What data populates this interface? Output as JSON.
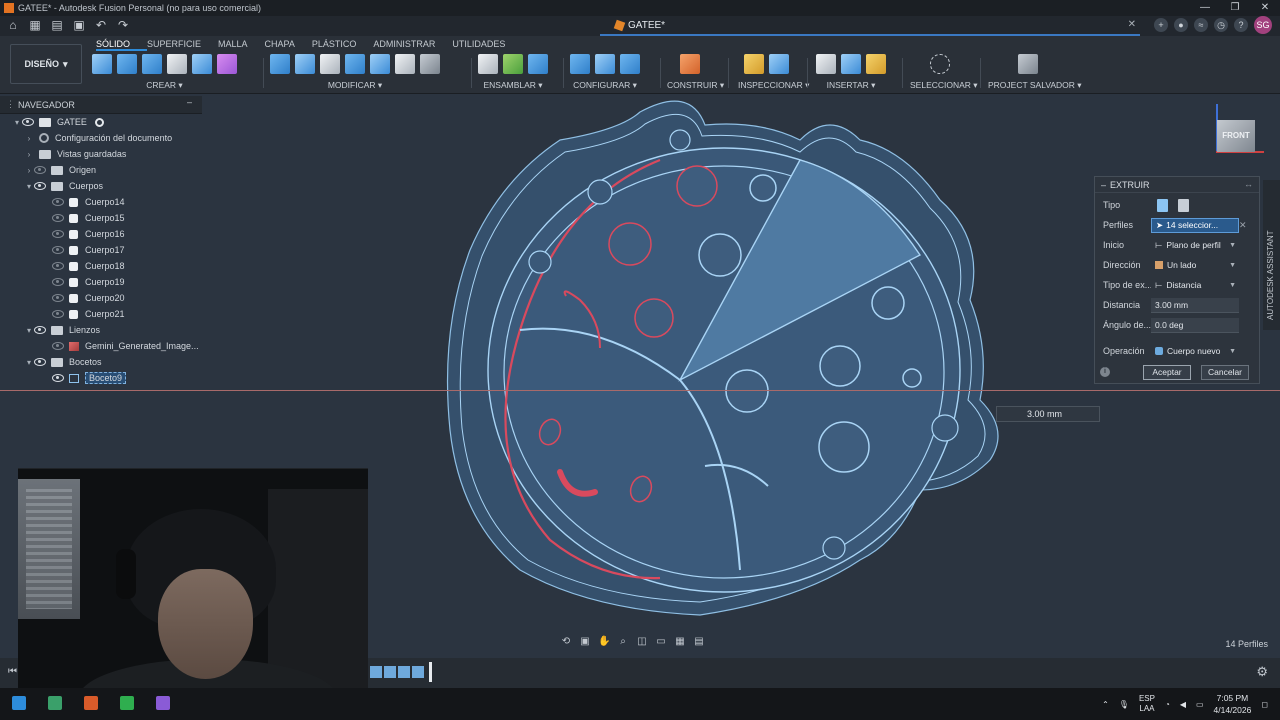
{
  "window": {
    "title": "GATEE* - Autodesk Fusion Personal (no para uso comercial)",
    "controls": [
      "—",
      "❐",
      "✕"
    ]
  },
  "tab": {
    "doc_title": "GATEE*",
    "close": "✕"
  },
  "user": {
    "initials": "SG"
  },
  "workspace": {
    "label": "DISEÑO"
  },
  "toolbar_tabs": [
    "SÓLIDO",
    "SUPERFICIE",
    "MALLA",
    "CHAPA",
    "PLÁSTICO",
    "ADMINISTRAR",
    "UTILIDADES"
  ],
  "tool_groups": [
    {
      "label": "CREAR ▾"
    },
    {
      "label": "MODIFICAR ▾"
    },
    {
      "label": "ENSAMBLAR ▾"
    },
    {
      "label": "CONFIGURAR ▾"
    },
    {
      "label": "CONSTRUIR ▾"
    },
    {
      "label": "INSPECCIONAR ▾"
    },
    {
      "label": "INSERTAR ▾"
    },
    {
      "label": "SELECCIONAR ▾"
    },
    {
      "label": "PROJECT SALVADOR ▾"
    }
  ],
  "browser": {
    "title": "NAVEGADOR",
    "root": "GATEE",
    "items": {
      "doc_settings": "Configuración del documento",
      "saved_views": "Vistas guardadas",
      "origin": "Origen",
      "bodies": "Cuerpos",
      "body_list": [
        "Cuerpo14",
        "Cuerpo15",
        "Cuerpo16",
        "Cuerpo17",
        "Cuerpo18",
        "Cuerpo19",
        "Cuerpo20",
        "Cuerpo21"
      ],
      "canvases": "Lienzos",
      "canvas_item": "Gemini_Generated_Image...",
      "sketches": "Bocetos",
      "sketch_item": "Boceto9"
    }
  },
  "viewcube": {
    "face": "FRONT"
  },
  "extrude": {
    "title": "EXTRUIR",
    "labels": {
      "type": "Tipo",
      "profiles": "Perfiles",
      "start": "Inicio",
      "direction": "Dirección",
      "extent_type": "Tipo de ex...",
      "distance": "Distancia",
      "angle": "Ángulo de...",
      "operation": "Operación"
    },
    "values": {
      "profiles": "14 seleccior...",
      "start": "Plano de perfil",
      "direction": "Un lado",
      "extent_type": "Distancia",
      "distance": "3.00 mm",
      "angle": "0.0 deg",
      "operation": "Cuerpo nuevo"
    },
    "ok": "Aceptar",
    "cancel": "Cancelar"
  },
  "dimension_box": "3.00 mm",
  "assistant_tab": "AUTODESK ASSISTANT",
  "status": {
    "profiles": "14 Perfiles"
  },
  "tray": {
    "lang_top": "ESP",
    "lang_bottom": "LAA",
    "time": "7:05 PM",
    "date": "4/14/2026"
  },
  "colors": {
    "accent": "#2d8cdb",
    "profile_fill": "#3f5f80",
    "outline": "#a9d4f5",
    "selected_red": "#d94a5e"
  }
}
